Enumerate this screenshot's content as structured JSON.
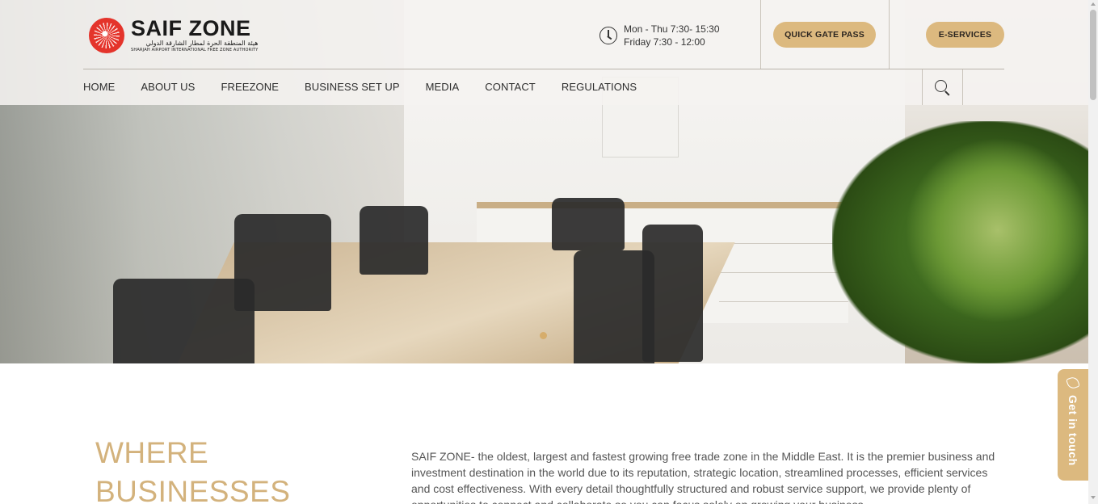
{
  "logo": {
    "title": "SAIF ZONE",
    "arabic": "هيئة المنطقة الحرة لمطار الشارقة الدولي",
    "subtitle": "SHARJAH AIRPORT INTERNATIONAL FREE ZONE AUTHORITY"
  },
  "hours": {
    "line1": "Mon - Thu 7:30- 15:30",
    "line2": "Friday 7:30 - 12:00"
  },
  "header_buttons": {
    "quick_gate_pass": "QUICK GATE PASS",
    "e_services": "E-SERVICES"
  },
  "nav": {
    "items": [
      "HOME",
      "ABOUT US",
      "FREEZONE",
      "BUSINESS SET UP",
      "MEDIA",
      "CONTACT",
      "REGULATIONS"
    ]
  },
  "icons": {
    "clock": "clock-icon",
    "search": "search-icon",
    "phone": "phone-icon"
  },
  "colors": {
    "accent": "#dcb97f",
    "headline": "#d3b27c",
    "logo_red": "#e4342b"
  },
  "hero": {
    "slide_index": 1,
    "slide_count": 1
  },
  "content": {
    "headline_line1": "WHERE",
    "headline_line2": "BUSINESSES",
    "paragraph": "SAIF ZONE- the oldest, largest and fastest growing free trade zone in the Middle East. It is the premier business and investment destination in the world due to its reputation, strategic location, streamlined processes, efficient services and cost effectiveness. With every detail thoughtfully structured and robust service support, we provide plenty of opportunities to connect and collaborate so you can focus solely on growing your business."
  },
  "get_in_touch": "Get in touch"
}
